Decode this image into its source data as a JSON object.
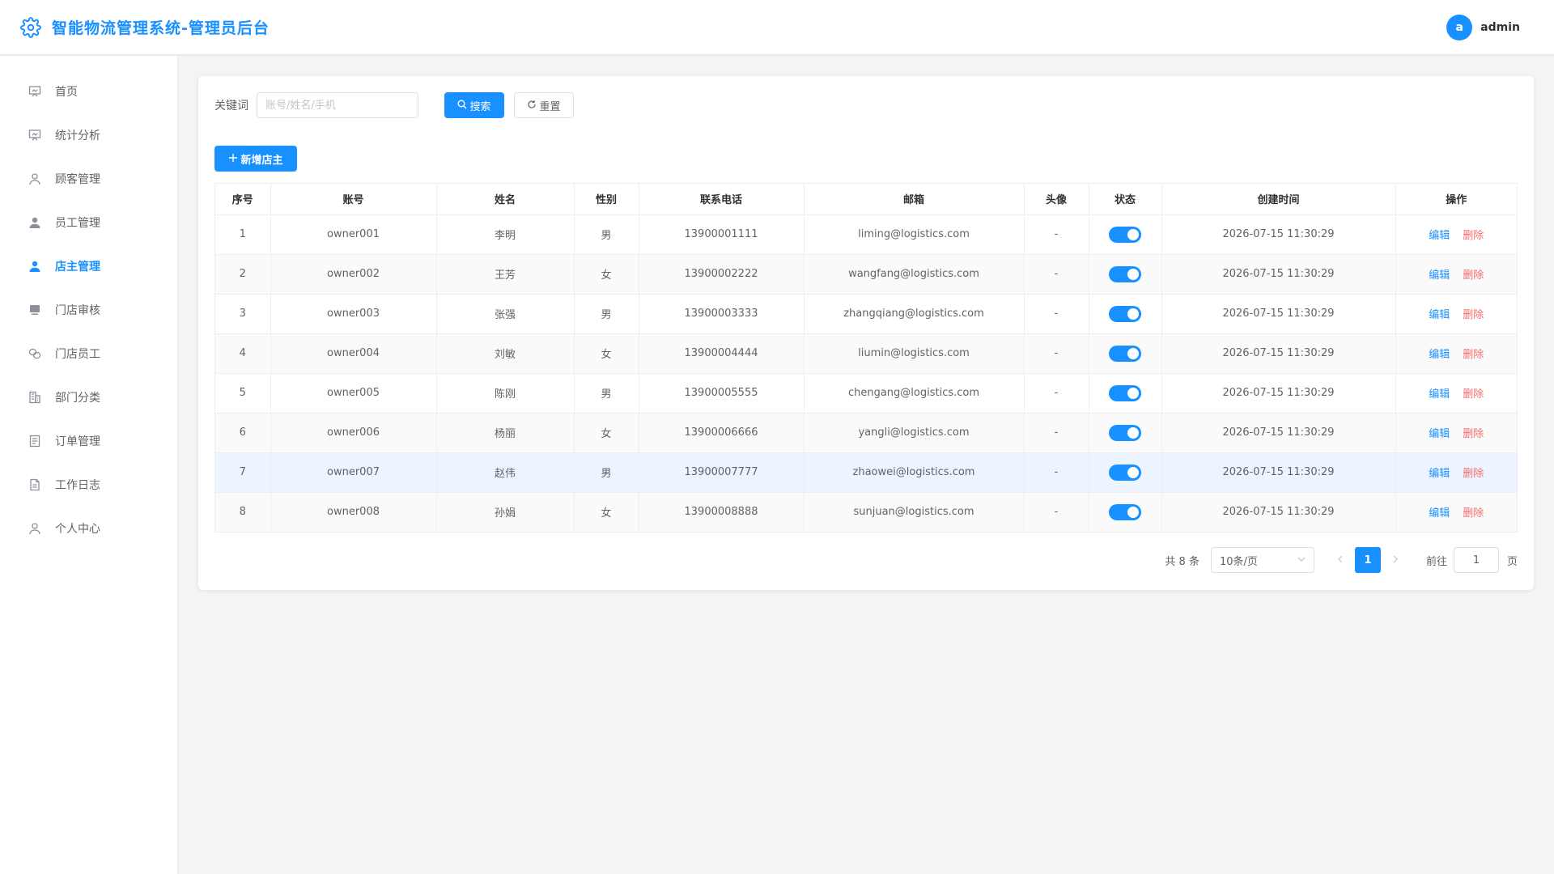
{
  "header": {
    "title": "智能物流管理系统-管理员后台",
    "avatar_letter": "a",
    "username": "admin"
  },
  "sidebar": {
    "items": [
      {
        "label": "首页",
        "icon": "dashboard-icon"
      },
      {
        "label": "统计分析",
        "icon": "chart-board-icon"
      },
      {
        "label": "顾客管理",
        "icon": "user-outline-icon"
      },
      {
        "label": "员工管理",
        "icon": "user-filled-icon"
      },
      {
        "label": "店主管理",
        "icon": "user-filled-icon",
        "active": true
      },
      {
        "label": "门店审核",
        "icon": "monitor-icon"
      },
      {
        "label": "门店员工",
        "icon": "link-icon"
      },
      {
        "label": "部门分类",
        "icon": "office-building-icon"
      },
      {
        "label": "订单管理",
        "icon": "tickets-icon"
      },
      {
        "label": "工作日志",
        "icon": "document-icon"
      },
      {
        "label": "个人中心",
        "icon": "user-outline-icon"
      }
    ]
  },
  "search": {
    "label": "关键词",
    "placeholder": "账号/姓名/手机",
    "search_button": "搜索",
    "reset_button": "重置"
  },
  "add_button": "新增店主",
  "table": {
    "columns": [
      "序号",
      "账号",
      "姓名",
      "性别",
      "联系电话",
      "邮箱",
      "头像",
      "状态",
      "创建时间",
      "操作"
    ],
    "rows": [
      {
        "no": "1",
        "account": "owner001",
        "name": "李明",
        "gender": "男",
        "phone": "13900001111",
        "email": "liming@logistics.com",
        "avatar": "-",
        "enabled": true,
        "created": "2026-07-15 11:30:29"
      },
      {
        "no": "2",
        "account": "owner002",
        "name": "王芳",
        "gender": "女",
        "phone": "13900002222",
        "email": "wangfang@logistics.com",
        "avatar": "-",
        "enabled": true,
        "created": "2026-07-15 11:30:29"
      },
      {
        "no": "3",
        "account": "owner003",
        "name": "张强",
        "gender": "男",
        "phone": "13900003333",
        "email": "zhangqiang@logistics.com",
        "avatar": "-",
        "enabled": true,
        "created": "2026-07-15 11:30:29"
      },
      {
        "no": "4",
        "account": "owner004",
        "name": "刘敏",
        "gender": "女",
        "phone": "13900004444",
        "email": "liumin@logistics.com",
        "avatar": "-",
        "enabled": true,
        "created": "2026-07-15 11:30:29"
      },
      {
        "no": "5",
        "account": "owner005",
        "name": "陈刚",
        "gender": "男",
        "phone": "13900005555",
        "email": "chengang@logistics.com",
        "avatar": "-",
        "enabled": true,
        "created": "2026-07-15 11:30:29"
      },
      {
        "no": "6",
        "account": "owner006",
        "name": "杨丽",
        "gender": "女",
        "phone": "13900006666",
        "email": "yangli@logistics.com",
        "avatar": "-",
        "enabled": true,
        "created": "2026-07-15 11:30:29"
      },
      {
        "no": "7",
        "account": "owner007",
        "name": "赵伟",
        "gender": "男",
        "phone": "13900007777",
        "email": "zhaowei@logistics.com",
        "avatar": "-",
        "enabled": true,
        "created": "2026-07-15 11:30:29"
      },
      {
        "no": "8",
        "account": "owner008",
        "name": "孙娟",
        "gender": "女",
        "phone": "13900008888",
        "email": "sunjuan@logistics.com",
        "avatar": "-",
        "enabled": true,
        "created": "2026-07-15 11:30:29"
      }
    ],
    "actions": {
      "edit": "编辑",
      "delete": "删除"
    }
  },
  "pagination": {
    "total_text": "共 8 条",
    "page_size": "10条/页",
    "current_page": "1",
    "goto_label": "前往",
    "goto_value": "1",
    "page_suffix": "页"
  },
  "colors": {
    "primary": "#1890ff",
    "danger": "#f56c6c",
    "background": "#f3f4f6"
  }
}
